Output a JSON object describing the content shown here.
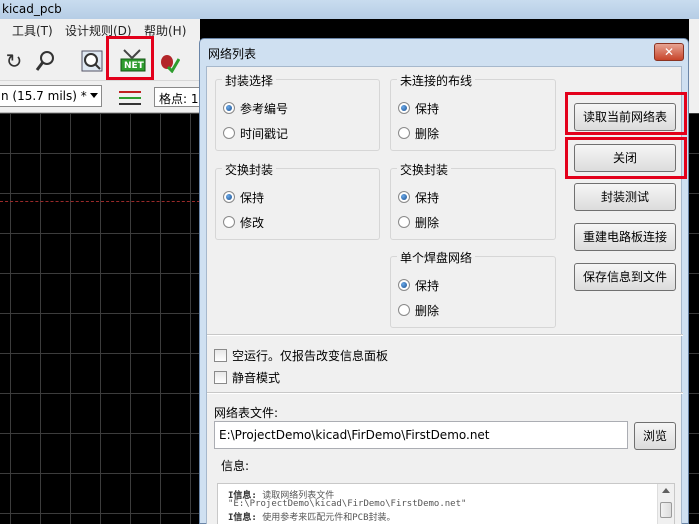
{
  "window": {
    "title": "kicad_pcb"
  },
  "menu": {
    "items": [
      "工具(T)",
      "设计规则(D)",
      "帮助(H)"
    ]
  },
  "toolbar": {
    "icons": [
      "redo-icon",
      "zoom-fit-icon",
      "zoom-search-icon",
      "netlist-icon",
      "drc-bug-icon"
    ],
    "netlist_label": "NET",
    "track_width": "n (15.7 mils) *",
    "grid_label": "格点: 1"
  },
  "dialog": {
    "title": "网络列表",
    "close_glyph": "✕",
    "groups": {
      "footprint_select": {
        "title": "封装选择",
        "options": [
          "参考编号",
          "时间戳记"
        ],
        "selected": 0
      },
      "unconnected_tracks": {
        "title": "未连接的布线",
        "options": [
          "保持",
          "删除"
        ],
        "selected": 0
      },
      "exchange_footprint_left": {
        "title": "交换封装",
        "options": [
          "保持",
          "修改"
        ],
        "selected": 0
      },
      "exchange_footprint_right": {
        "title": "交换封装",
        "options": [
          "保持",
          "删除"
        ],
        "selected": 0
      },
      "single_pad_nets": {
        "title": "单个焊盘网络",
        "options": [
          "保持",
          "删除"
        ],
        "selected": 0
      }
    },
    "buttons": {
      "read_netlist": "读取当前网络表",
      "close": "关闭",
      "test_footprints": "封装测试",
      "rebuild_board": "重建电路板连接",
      "save_messages": "保存信息到文件",
      "browse": "浏览"
    },
    "checkboxes": {
      "dry_run": {
        "label": "空运行。仅报告改变信息面板",
        "checked": false
      },
      "silent_mode": {
        "label": "静音模式",
        "checked": false
      }
    },
    "netlist_file_label": "网络表文件:",
    "netlist_file_value": "E:\\ProjectDemo\\kicad\\FirDemo\\FirstDemo.net",
    "messages_label": "信息:",
    "messages": [
      {
        "tag": "I信息:",
        "text": " 读取网络列表文件"
      },
      {
        "tag": "",
        "text": "\"E:\\ProjectDemo\\kicad\\FirDemo\\FirstDemo.net\""
      },
      {
        "tag": "I信息:",
        "text": " 使用参考来匹配元件和PCB封装。"
      }
    ]
  },
  "colors": {
    "highlight": "#e3001b",
    "dialog_frame": "#cfe0f1"
  }
}
